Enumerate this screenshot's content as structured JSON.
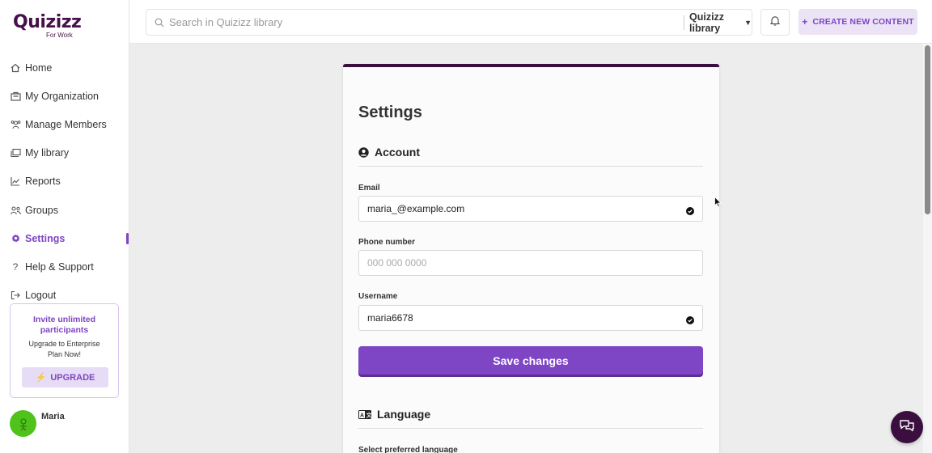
{
  "brand": {
    "name": "Quizizz",
    "sub": "For Work"
  },
  "sidebar": {
    "items": [
      {
        "label": "Home",
        "icon": "home-icon"
      },
      {
        "label": "My Organization",
        "icon": "organization-icon"
      },
      {
        "label": "Manage Members",
        "icon": "members-icon"
      },
      {
        "label": "My library",
        "icon": "library-icon"
      },
      {
        "label": "Reports",
        "icon": "reports-icon"
      },
      {
        "label": "Groups",
        "icon": "groups-icon"
      },
      {
        "label": "Settings",
        "icon": "gear-icon",
        "active": true
      },
      {
        "label": "Help & Support",
        "icon": "help-icon"
      },
      {
        "label": "Logout",
        "icon": "logout-icon"
      }
    ],
    "invite": {
      "title": "Invite unlimited participants",
      "subtitle": "Upgrade to Enterprise Plan Now!",
      "button": "UPGRADE"
    },
    "user": {
      "name": "Maria"
    }
  },
  "topbar": {
    "search_placeholder": "Search in Quizizz library",
    "library_select": "Quizizz library",
    "create_button": "CREATE NEW CONTENT"
  },
  "settings": {
    "title": "Settings",
    "account": {
      "heading": "Account",
      "email_label": "Email",
      "email_value": "maria_@example.com",
      "phone_label": "Phone number",
      "phone_placeholder": "000 000 0000",
      "username_label": "Username",
      "username_value": "maria6678",
      "save_button": "Save changes"
    },
    "language": {
      "heading": "Language",
      "select_label": "Select preferred language"
    }
  },
  "colors": {
    "accent": "#7e45c4",
    "brand_dark": "#46104a",
    "avatar": "#4fc21b"
  }
}
